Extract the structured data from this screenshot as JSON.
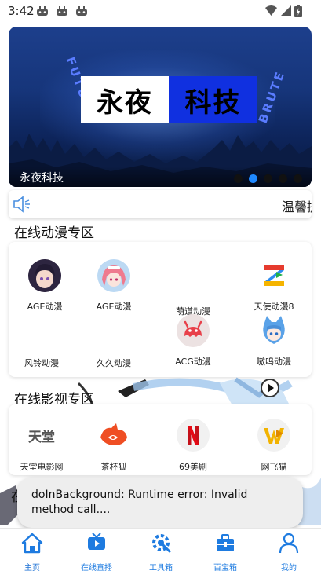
{
  "status_bar": {
    "time": "3:42",
    "icons": [
      "game-controller-icon",
      "game-controller-icon",
      "game-controller-icon",
      "wifi-icon",
      "signal-icon",
      "battery-icon"
    ]
  },
  "banner": {
    "logo_left": "永夜",
    "logo_right": "科技",
    "caption": "永夜科技",
    "dots_count": 5,
    "active_dot": 2,
    "accent": "#1e88ff"
  },
  "notice": {
    "icon": "speaker-icon",
    "text": "温馨提示"
  },
  "anime_section": {
    "title": "在线动漫专区",
    "items": [
      {
        "label": "AGE动漫",
        "icon": "dark-hair-girl-avatar-icon"
      },
      {
        "label": "AGE动漫",
        "icon": "pink-hair-girl-avatar-icon"
      },
      {
        "label": "萌道动漫",
        "icon": "blank-icon"
      },
      {
        "label": "天使动漫8",
        "icon": "colorful-z-logo-icon"
      },
      {
        "label": "风铃动漫",
        "icon": "blank-icon"
      },
      {
        "label": "久久动漫",
        "icon": "blank-icon"
      },
      {
        "label": "ACG动漫",
        "icon": "red-monster-icon"
      },
      {
        "label": "嗷呜动漫",
        "icon": "blue-cat-girl-icon"
      }
    ]
  },
  "video_section": {
    "title": "在线影视专区",
    "items": [
      {
        "label": "天堂电影网",
        "icon": "tiantang-logo-icon",
        "logo_text": "天堂"
      },
      {
        "label": "茶杯狐",
        "icon": "red-fox-icon"
      },
      {
        "label": "69美剧",
        "icon": "netflix-n-icon"
      },
      {
        "label": "网飞猫",
        "icon": "w-play-logo-icon"
      }
    ]
  },
  "toast": {
    "text": "doInBackground: Runtime error: Invalid method call...."
  },
  "bottom_nav": {
    "items": [
      {
        "label": "主页",
        "icon": "home-icon",
        "active": true
      },
      {
        "label": "在线直播",
        "icon": "tv-icon",
        "active": false
      },
      {
        "label": "工具箱",
        "icon": "wrench-gear-icon",
        "active": false
      },
      {
        "label": "百宝箱",
        "icon": "toolbox-icon",
        "active": false
      },
      {
        "label": "我的",
        "icon": "person-icon",
        "active": false
      }
    ],
    "color": "#1e7be0"
  }
}
